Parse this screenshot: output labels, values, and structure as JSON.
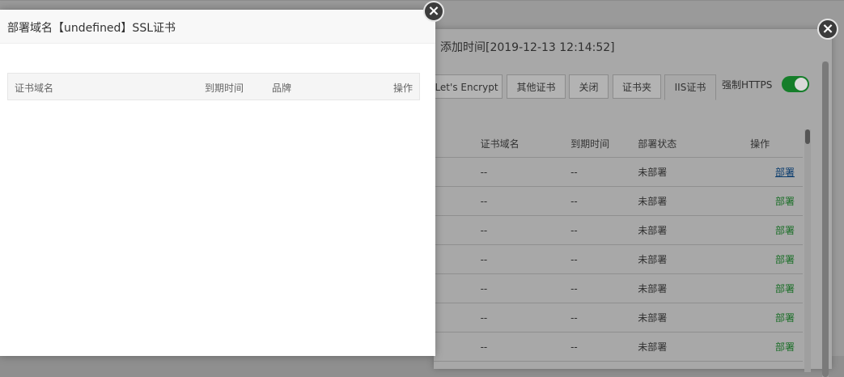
{
  "back_dialog": {
    "title": "添加时间[2019-12-13 12:14:52]",
    "tabs": [
      "Let's Encrypt",
      "其他证书",
      "关闭",
      "证书夹",
      "IIS证书"
    ],
    "active_tab": "IIS证书",
    "https_label": "强制HTTPS",
    "https_enabled": true,
    "table": {
      "headers": [
        "证书域名",
        "到期时间",
        "部署状态",
        "操作"
      ],
      "rows": [
        {
          "domain": "--",
          "expire": "--",
          "status": "未部署",
          "action": "部署"
        },
        {
          "domain": "--",
          "expire": "--",
          "status": "未部署",
          "action": "部署"
        },
        {
          "domain": "--",
          "expire": "--",
          "status": "未部署",
          "action": "部署"
        },
        {
          "domain": "--",
          "expire": "--",
          "status": "未部署",
          "action": "部署"
        },
        {
          "domain": "--",
          "expire": "--",
          "status": "未部署",
          "action": "部署"
        },
        {
          "domain": "--",
          "expire": "--",
          "status": "未部署",
          "action": "部署"
        },
        {
          "domain": "--",
          "expire": "--",
          "status": "未部署",
          "action": "部署"
        }
      ]
    }
  },
  "front_dialog": {
    "title": "部署域名【undefined】SSL证书",
    "table_headers": {
      "domain": "证书域名",
      "expire": "到期时间",
      "brand": "品牌",
      "action": "操作"
    }
  },
  "icons": {
    "close": "close-icon",
    "close_glyph": "×"
  },
  "colors": {
    "toggle_on": "#157e2a",
    "action_link": "#1a6e27"
  }
}
